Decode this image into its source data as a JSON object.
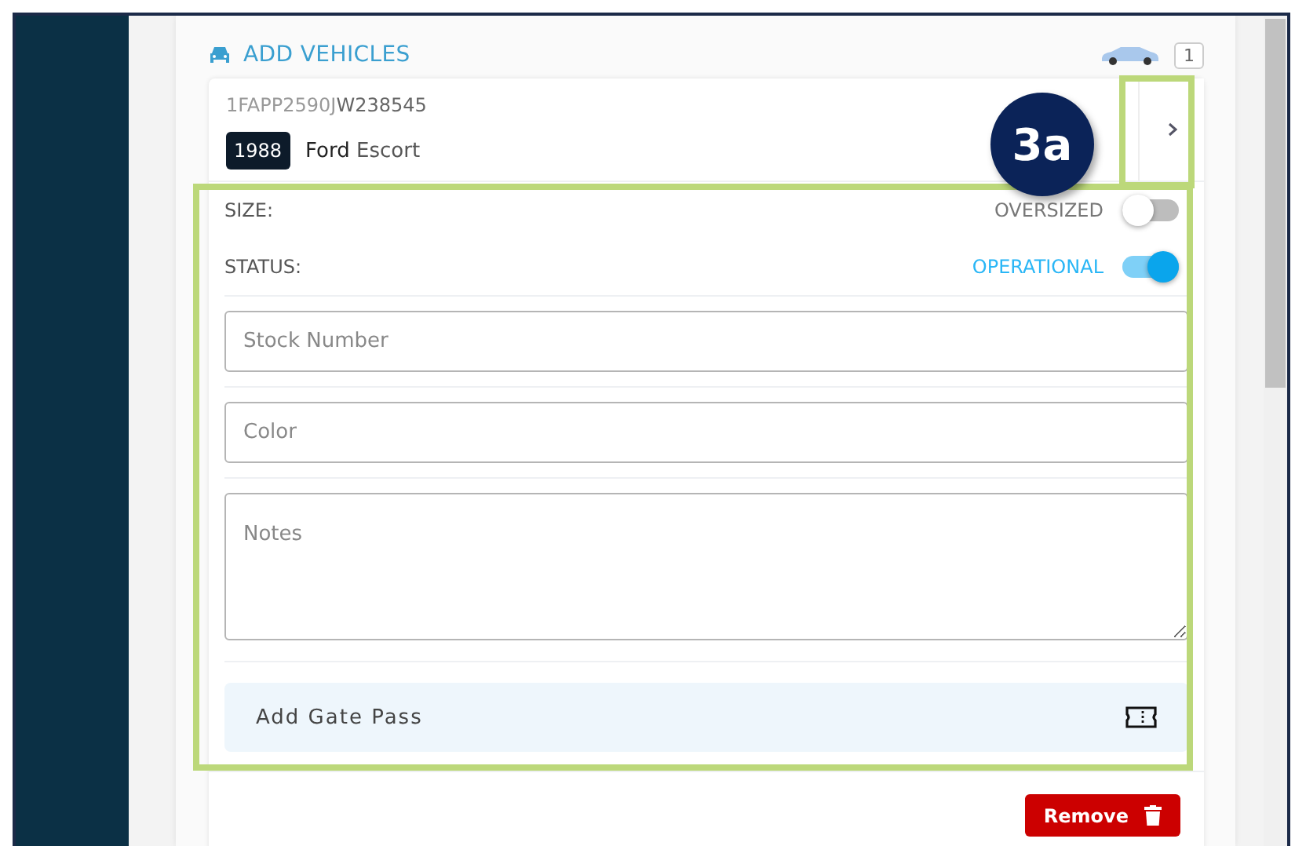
{
  "section": {
    "title": "ADD VEHICLES",
    "count": "1"
  },
  "vehicle": {
    "vin_prefix": "1FAPP2590J",
    "vin_suffix": "W238545",
    "year": "1988",
    "make": "Ford",
    "model": "Escort",
    "expanded": true
  },
  "toggles": [
    {
      "label": "SIZE:",
      "value": "OVERSIZED",
      "on": false
    },
    {
      "label": "STATUS:",
      "value": "OPERATIONAL",
      "on": true
    }
  ],
  "fields": [
    {
      "kind": "input",
      "placeholder": "Stock Number"
    },
    {
      "kind": "input",
      "placeholder": "Color"
    },
    {
      "kind": "textarea",
      "placeholder": "Notes"
    }
  ],
  "gate_pass": {
    "label": "Add Gate Pass"
  },
  "remove_button": {
    "label": "Remove"
  },
  "callout": {
    "label": "3a"
  }
}
